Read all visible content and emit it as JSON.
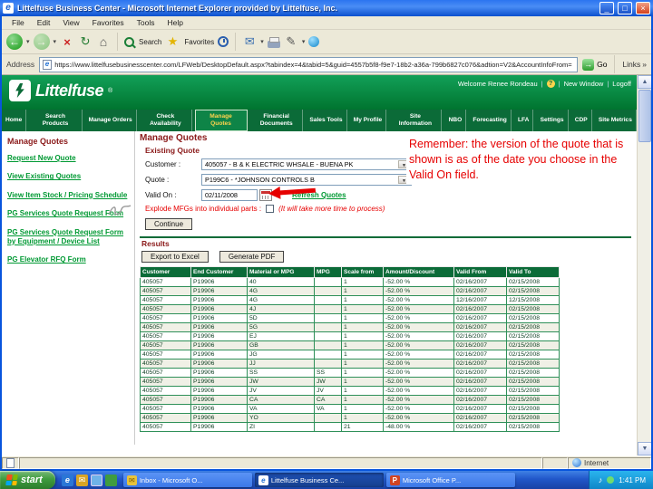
{
  "colors": {
    "brand_green": "#12A058",
    "nav_green": "#0B6B38",
    "table_header_green": "#0B6B38",
    "link_green": "#009933",
    "heading_maroon": "#8B1A1A",
    "annotation_red": "#E60000",
    "start_green": "#3F9C3F"
  },
  "titlebar": {
    "title": "Littelfuse Business Center - Microsoft Internet Explorer provided by Littelfuse, Inc."
  },
  "menu": {
    "items": [
      "File",
      "Edit",
      "View",
      "Favorites",
      "Tools",
      "Help"
    ]
  },
  "toolbar": {
    "search_label": "Search",
    "favorites_label": "Favorites"
  },
  "address": {
    "label": "Address",
    "url": "https://www.littelfusebusinesscenter.com/LFWeb/DesktopDefault.aspx?tabindex=4&tabid=5&guid=4557b5f8-f9e7-18b2-a36a-799b6827c076&adtion=V2&AccountInfoFrom=",
    "go": "Go",
    "links": "Links"
  },
  "banner": {
    "logo_text": "Littelfuse",
    "reg_mark": "®",
    "welcome": "Welcome Renee Rondeau",
    "new_window": "New Window",
    "logoff": "Logoff"
  },
  "nav": {
    "items": [
      "Home",
      "Search Products",
      "Manage Orders",
      "Check Availability",
      "Manage Quotes",
      "Financial Documents",
      "Sales Tools",
      "My Profile",
      "Site Information",
      "NBO",
      "Forecasting",
      "LFA",
      "Settings",
      "CDP",
      "Site Metrics"
    ],
    "active": "Manage Quotes"
  },
  "sidebar": {
    "title": "Manage Quotes",
    "items": [
      "Request New Quote",
      "View Existing Quotes",
      "View Item Stock / Pricing Schedule",
      "PG Services Quote Request Form",
      "PG Services Quote Request Form by Equipment / Device List",
      "PG Elevator RFQ Form"
    ]
  },
  "main": {
    "title": "Manage Quotes",
    "section_title": "Existing Quote",
    "customer_label": "Customer :",
    "customer_value": "405057 - B & K ELECTRIC WHSALE - BUENA PK",
    "quote_label": "Quote :",
    "quote_value": "P199C6 - *JOHNSON CONTROLS B",
    "valid_on_label": "Valid On :",
    "valid_on_value": "02/11/2008",
    "refresh_quotes_link": "Refresh Quotes",
    "explode_label": "Explode MFGs into individual parts :",
    "explode_note": "(It will take more time to process)",
    "continue_button": "Continue",
    "results_title": "Results",
    "export_excel_button": "Export to Excel",
    "generate_pdf_button": "Generate PDF"
  },
  "table": {
    "headers": [
      "Customer",
      "End Customer",
      "Material or MPG",
      "MPG",
      "Scale from",
      "Amount/Discount",
      "Valid From",
      "Valid To"
    ],
    "rows": [
      [
        "405057",
        "P19906",
        "40",
        "",
        "1",
        "-52.00 %",
        "02/16/2007",
        "02/15/2008"
      ],
      [
        "405057",
        "P19906",
        "4G",
        "",
        "1",
        "-52.00 %",
        "02/16/2007",
        "02/15/2008"
      ],
      [
        "405057",
        "P19906",
        "4G",
        "",
        "1",
        "-52.00 %",
        "12/16/2007",
        "12/15/2008"
      ],
      [
        "405057",
        "P19906",
        "4J",
        "",
        "1",
        "-52.00 %",
        "02/16/2007",
        "02/15/2008"
      ],
      [
        "405057",
        "P19906",
        "5D",
        "",
        "1",
        "-52.00 %",
        "02/16/2007",
        "02/15/2008"
      ],
      [
        "405057",
        "P19906",
        "5G",
        "",
        "1",
        "-52.00 %",
        "02/16/2007",
        "02/15/2008"
      ],
      [
        "405057",
        "P19906",
        "EJ",
        "",
        "1",
        "-52.00 %",
        "02/16/2007",
        "02/15/2008"
      ],
      [
        "405057",
        "P19906",
        "GB",
        "",
        "1",
        "-52.00 %",
        "02/16/2007",
        "02/15/2008"
      ],
      [
        "405057",
        "P19906",
        "JG",
        "",
        "1",
        "-52.00 %",
        "02/16/2007",
        "02/15/2008"
      ],
      [
        "405057",
        "P19906",
        "JJ",
        "",
        "1",
        "-52.00 %",
        "02/16/2007",
        "02/15/2008"
      ],
      [
        "405057",
        "P19906",
        "SS",
        "SS",
        "1",
        "-52.00 %",
        "02/16/2007",
        "02/15/2008"
      ],
      [
        "405057",
        "P19906",
        "JW",
        "JW",
        "1",
        "-52.00 %",
        "02/16/2007",
        "02/15/2008"
      ],
      [
        "405057",
        "P19906",
        "JV",
        "JV",
        "1",
        "-52.00 %",
        "02/16/2007",
        "02/15/2008"
      ],
      [
        "405057",
        "P19906",
        "CA",
        "CA",
        "1",
        "-52.00 %",
        "02/16/2007",
        "02/15/2008"
      ],
      [
        "405057",
        "P19906",
        "VA",
        "VA",
        "1",
        "-52.00 %",
        "02/16/2007",
        "02/15/2008"
      ],
      [
        "405057",
        "P19906",
        "YO",
        "",
        "1",
        "-52.00 %",
        "02/16/2007",
        "02/15/2008"
      ],
      [
        "405057",
        "P19906",
        "ZI",
        "",
        "21",
        "-48.00 %",
        "02/16/2007",
        "02/15/2008"
      ]
    ]
  },
  "annotation": {
    "text": "Remember:  the version of the quote that is shown is as of the date you choose in the Valid On field."
  },
  "status": {
    "internet": "Internet"
  },
  "taskbar": {
    "start_label": "start",
    "tasks": [
      {
        "label": "Inbox - Microsoft O...",
        "icon": "outlook-icon",
        "glyph": "✉",
        "active": false
      },
      {
        "label": "Littelfuse Business Ce...",
        "icon": "ie-icon",
        "glyph": "e",
        "active": true
      },
      {
        "label": "Microsoft Office P...",
        "icon": "powerpoint-icon",
        "glyph": "P",
        "active": false
      }
    ],
    "clock": "1:41 PM"
  }
}
